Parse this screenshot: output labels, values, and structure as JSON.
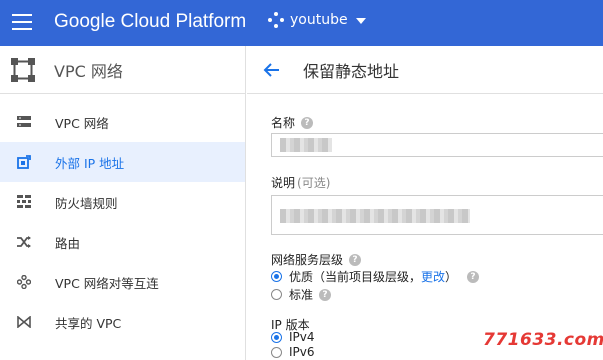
{
  "topbar": {
    "app_title": "Google Cloud Platform",
    "project_name": "youtube",
    "bg_color": "#3367d6"
  },
  "sidebar": {
    "title": "VPC 网络",
    "items": [
      {
        "label": "VPC 网络",
        "icon": "vpc-network-icon",
        "active": false
      },
      {
        "label": "外部 IP 地址",
        "icon": "external-ip-icon",
        "active": true
      },
      {
        "label": "防火墙规则",
        "icon": "firewall-icon",
        "active": false
      },
      {
        "label": "路由",
        "icon": "routes-icon",
        "active": false
      },
      {
        "label": "VPC 网络对等互连",
        "icon": "peering-icon",
        "active": false
      },
      {
        "label": "共享的 VPC",
        "icon": "shared-vpc-icon",
        "active": false
      }
    ]
  },
  "main": {
    "page_title": "保留静态地址",
    "name_label": "名称",
    "description_label": "说明",
    "description_optional": "(可选)",
    "network_tier_label": "网络服务层级",
    "tier_premium_prefix": "优质（当前项目级层级，",
    "tier_premium_link": "更改",
    "tier_premium_suffix": "）",
    "tier_standard": "标准",
    "ip_version_label": "IP 版本",
    "ipv4": "IPv4",
    "ipv6": "IPv6"
  },
  "watermark": "771633.com",
  "colors": {
    "accent": "#1a73e8",
    "active_bg": "#e8f0fe"
  }
}
